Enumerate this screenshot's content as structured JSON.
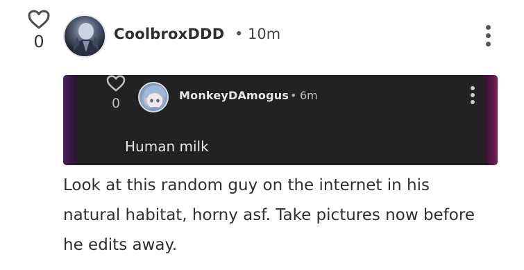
{
  "comment": {
    "likes": "0",
    "username": "CoolbroxDDD",
    "separator": "•",
    "time": "10m",
    "quoted": {
      "likes": "0",
      "username": "MonkeyDAmogus",
      "separator": "•",
      "time": "6m",
      "text": "Human milk"
    },
    "body": "Look at this random guy on the internet in his natural habitat, horny asf. Take pictures now before he edits away."
  },
  "icons": {
    "like": "heart-outline-icon",
    "more": "more-vertical-icon"
  },
  "colors": {
    "card_bg": "#222222",
    "text": "#2f2f2f"
  }
}
